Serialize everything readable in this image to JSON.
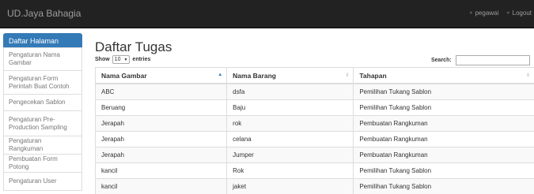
{
  "navbar": {
    "brand": "UD.Jaya Bahagia",
    "user_link": "pegawai",
    "logout_link": "Logout"
  },
  "sidebar": {
    "items": [
      {
        "label": "Daftar Halaman"
      },
      {
        "label": "Pengaturan Nama Gambar"
      },
      {
        "label": "Pengaturan Form Perintah Buat Contoh"
      },
      {
        "label": "Pengecekan Sablon"
      },
      {
        "label": "Pengaturan Pre-Production Sampling"
      },
      {
        "label": "Pengaturan Rangkuman"
      },
      {
        "label": "Pembuatan Form Potong"
      },
      {
        "label": "Pengaturan User"
      }
    ]
  },
  "main": {
    "title": "Daftar Tugas",
    "show_label": "Show",
    "entries_value": "10",
    "entries_label": "entries",
    "search_label": "Search:",
    "columns": [
      "Nama Gambar",
      "Nama Barang",
      "Tahapan"
    ],
    "rows": [
      [
        "ABC",
        "dsfa",
        "Pemilihan Tukang Sablon"
      ],
      [
        "Beruang",
        "Baju",
        "Pemilihan Tukang Sablon"
      ],
      [
        "Jerapah",
        "rok",
        "Pembuatan Rangkuman"
      ],
      [
        "Jerapah",
        "celana",
        "Pembuatan Rangkuman"
      ],
      [
        "Jerapah",
        "Jumper",
        "Pembuatan Rangkuman"
      ],
      [
        "kancil",
        "Rok",
        "Pemilihan Tukang Sablon"
      ],
      [
        "kancil",
        "jaket",
        "Pemilihan Tukang Sablon"
      ]
    ]
  },
  "colors": {
    "navbar_bg": "#222222",
    "accent": "#337ab7",
    "border": "#dddddd"
  }
}
